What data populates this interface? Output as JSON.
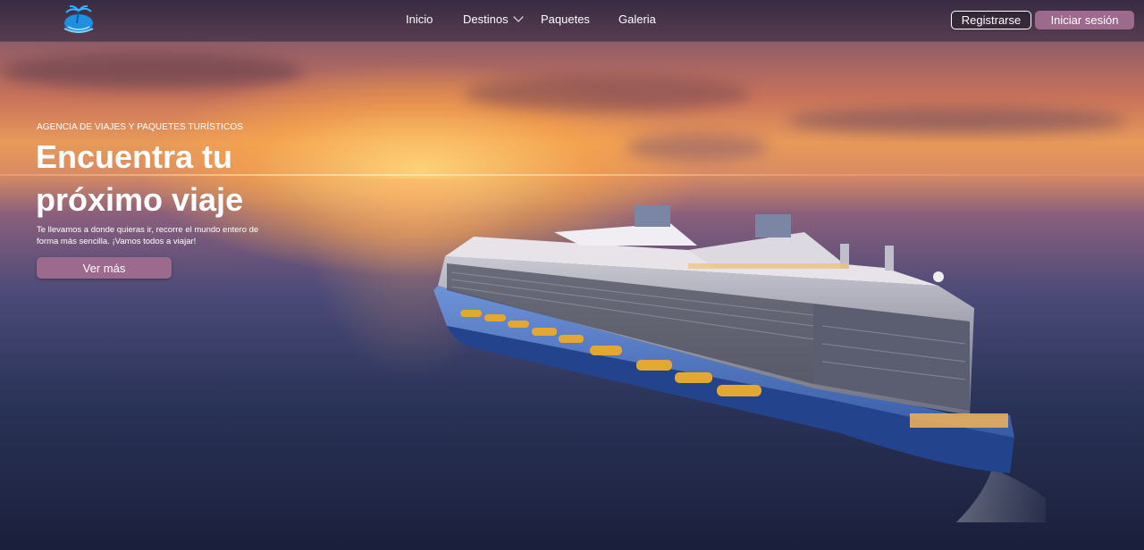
{
  "nav": {
    "links": [
      {
        "label": "Inicio"
      },
      {
        "label": "Destinos",
        "has_dropdown": true
      },
      {
        "label": "Paquetes"
      },
      {
        "label": "Galeria"
      }
    ],
    "register_label": "Registrarse",
    "login_label": "Iniciar sesión"
  },
  "hero": {
    "kicker": "AGENCIA DE VIAJES Y PAQUETES TURÍSTICOS",
    "title": "Encuentra tu próximo viaje",
    "description": "Te llevamos a donde quieras ir, recorre el mundo entero de forma más sencilla. ¡Vamos todos a viajar!",
    "cta_label": "Ver más",
    "background_image": "cruise-ship-at-sunset"
  },
  "colors": {
    "accent": "#9b6a8c",
    "navbar": "#282037"
  },
  "icons": {
    "logo": "palm-island-logo-icon",
    "dropdown": "chevron-down-icon"
  }
}
